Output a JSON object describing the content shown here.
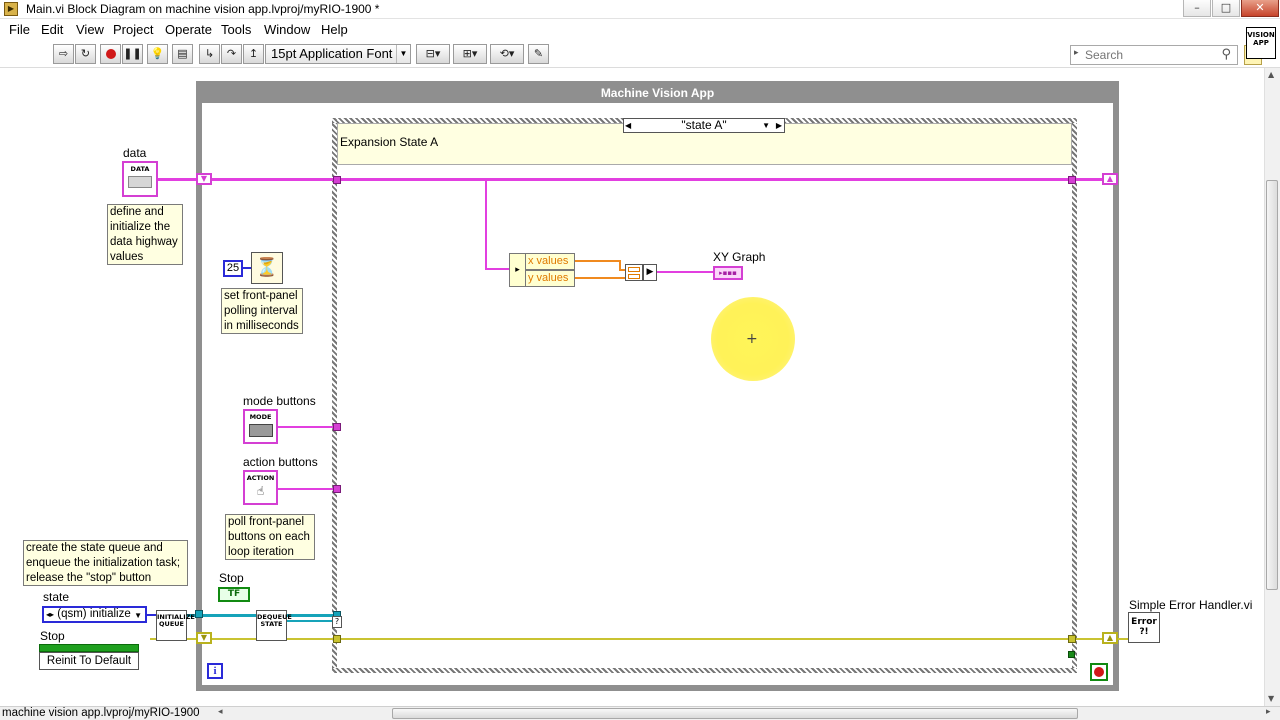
{
  "window": {
    "title": "Main.vi Block Diagram on machine vision app.lvproj/myRIO-1900 *",
    "minimize": "–",
    "maximize": "□",
    "close": "✕"
  },
  "menu": [
    "File",
    "Edit",
    "View",
    "Project",
    "Operate",
    "Tools",
    "Window",
    "Help"
  ],
  "toolbar": {
    "font": "15pt Application Font",
    "search_placeholder": "Search",
    "help": "?",
    "vi_icon_line1": "VISION",
    "vi_icon_line2": "APP"
  },
  "diagram": {
    "while_loop_title": "Machine Vision App",
    "case_selector": "\"state A\"",
    "case_comment": "Expansion State A",
    "data_label": "data",
    "data_node": "DATA",
    "data_comment": "define and\ninitialize the\ndata highway\nvalues",
    "polling_value": "25",
    "polling_comment": "set front-panel\npolling interval\nin milliseconds",
    "mode_label": "mode buttons",
    "mode_node": "MODE",
    "action_label": "action buttons",
    "action_node": "ACTION",
    "buttons_comment": "poll front-panel\nbuttons on each\nloop iteration",
    "state_comment": "create the state queue and\nenqueue the initialization task;\nrelease the \"stop\" button",
    "state_label": "state",
    "state_value": "(qsm) initialize",
    "stop_label_top": "Stop",
    "stop_bool": "TF",
    "stop_label": "Stop",
    "reinit_value": "Reinit To Default",
    "init_queue_node": "INITIALIZE\nQUEUE",
    "dequeue_node": "DEQUEUE\nSTATE",
    "unbundle_x": "x values",
    "unbundle_y": "y values",
    "xy_graph_label": "XY Graph",
    "error_handler_label": "Simple Error Handler.vi",
    "error_node": "Error\n?!",
    "info_icon": "i"
  },
  "status": {
    "project_path": "machine vision app.lvproj/myRIO-1900"
  },
  "colors": {
    "data_wire": "#e23fe0",
    "queue_wire": "#16a3b9",
    "error_wire": "#c9c331",
    "numeric_wire": "#f08a1f",
    "comment_bg": "#ffffe1"
  }
}
